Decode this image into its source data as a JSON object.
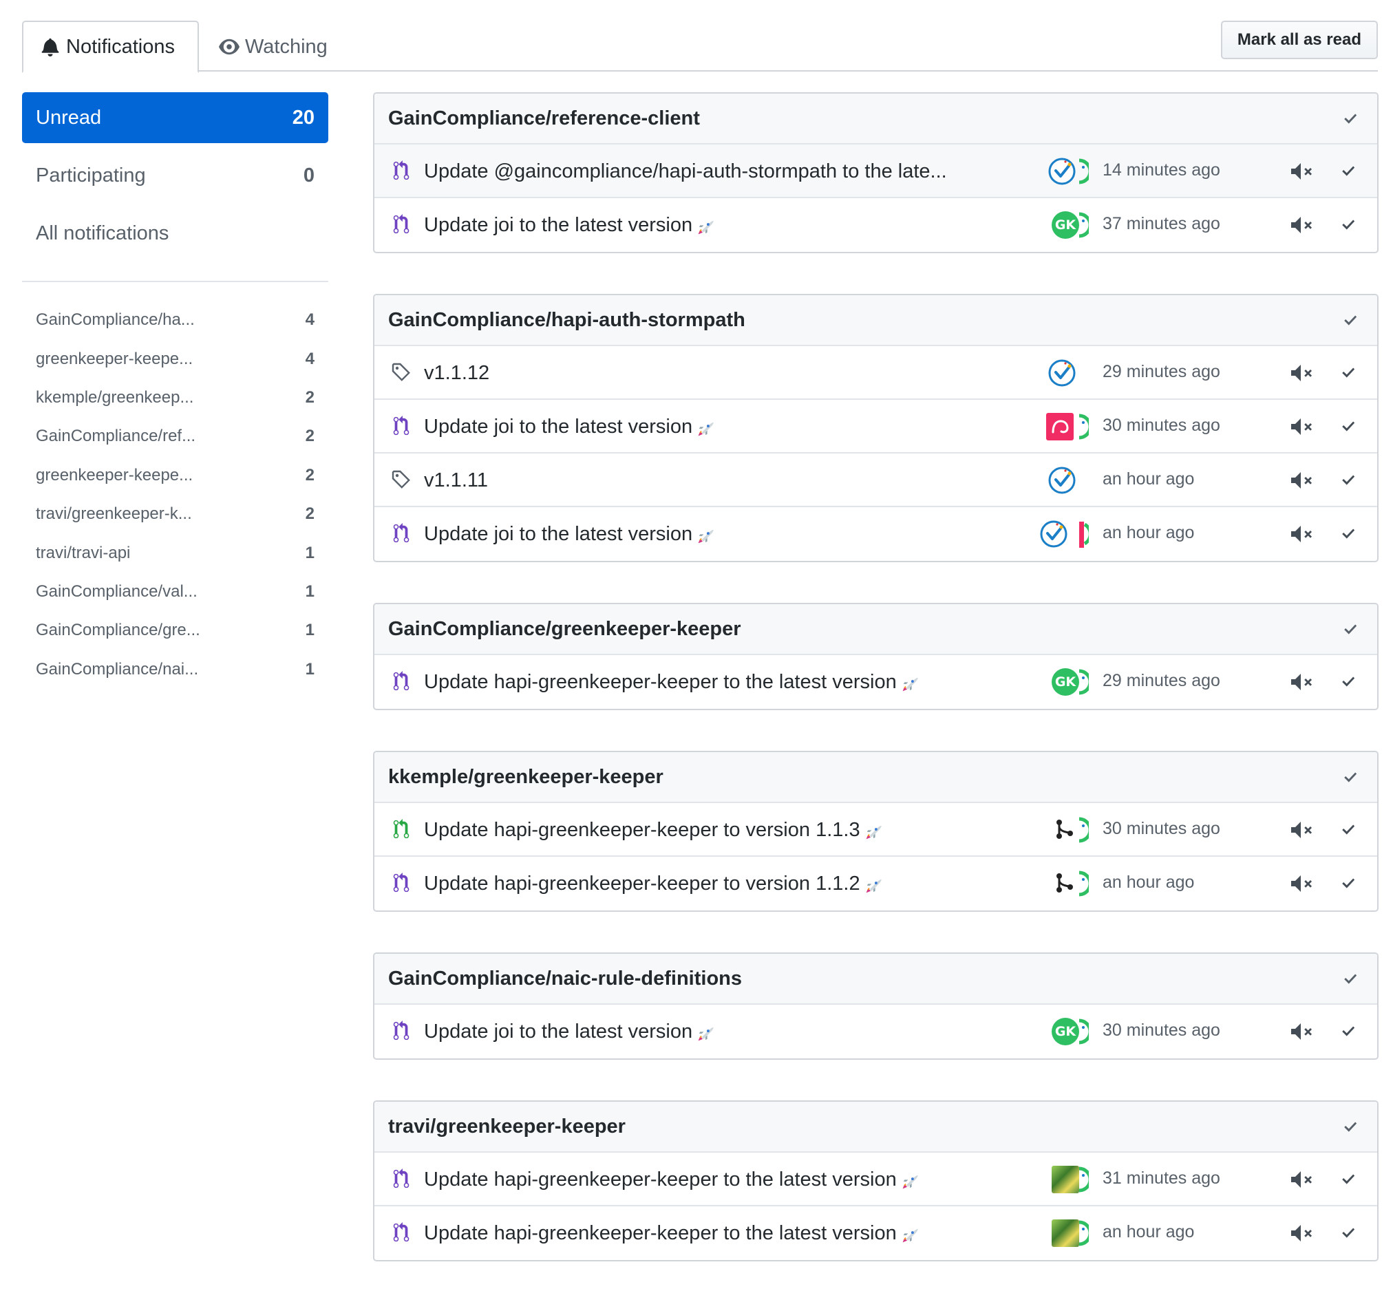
{
  "tabs": {
    "notifications": "Notifications",
    "watching": "Watching"
  },
  "mark_all_read": "Mark all as read",
  "filters": [
    {
      "label": "Unread",
      "count": "20",
      "active": true
    },
    {
      "label": "Participating",
      "count": "0",
      "active": false
    },
    {
      "label": "All notifications",
      "count": "",
      "active": false
    }
  ],
  "repos": [
    {
      "label": "GainCompliance/ha...",
      "count": "4"
    },
    {
      "label": "greenkeeper-keepe...",
      "count": "4"
    },
    {
      "label": "kkemple/greenkeep...",
      "count": "2"
    },
    {
      "label": "GainCompliance/ref...",
      "count": "2"
    },
    {
      "label": "greenkeeper-keepe...",
      "count": "2"
    },
    {
      "label": "travi/greenkeeper-k...",
      "count": "2"
    },
    {
      "label": "travi/travi-api",
      "count": "1"
    },
    {
      "label": "GainCompliance/val...",
      "count": "1"
    },
    {
      "label": "GainCompliance/gre...",
      "count": "1"
    },
    {
      "label": "GainCompliance/nai...",
      "count": "1"
    }
  ],
  "groups": [
    {
      "title": "GainCompliance/reference-client",
      "items": [
        {
          "type": "pr-open",
          "title": "Update @gaincompliance/hapi-auth-stormpath to the late...",
          "rocket": false,
          "avatar": "check-badge",
          "partial": "green",
          "time": "14 minutes ago",
          "hover": true
        },
        {
          "type": "pr-open",
          "title": "Update joi to the latest version",
          "rocket": true,
          "avatar": "gk",
          "partial": "green",
          "time": "37 minutes ago"
        }
      ]
    },
    {
      "title": "GainCompliance/hapi-auth-stormpath",
      "items": [
        {
          "type": "tag",
          "title": "v1.1.12",
          "rocket": false,
          "avatar": "check-badge",
          "partial": "",
          "time": "29 minutes ago"
        },
        {
          "type": "pr-open",
          "title": "Update joi to the latest version",
          "rocket": true,
          "avatar": "pink",
          "partial": "green",
          "time": "30 minutes ago"
        },
        {
          "type": "tag",
          "title": "v1.1.11",
          "rocket": false,
          "avatar": "check-badge",
          "partial": "",
          "time": "an hour ago"
        },
        {
          "type": "pr-open",
          "title": "Update joi to the latest version",
          "rocket": true,
          "avatar": "check-badge",
          "partial": "pink",
          "time": "an hour ago"
        }
      ]
    },
    {
      "title": "GainCompliance/greenkeeper-keeper",
      "items": [
        {
          "type": "pr-open",
          "title": "Update hapi-greenkeeper-keeper to the latest version",
          "rocket": true,
          "avatar": "gk",
          "partial": "green",
          "time": "29 minutes ago"
        }
      ]
    },
    {
      "title": "kkemple/greenkeeper-keeper",
      "items": [
        {
          "type": "pr-merged",
          "title": "Update hapi-greenkeeper-keeper to version 1.1.3",
          "rocket": true,
          "avatar": "merge-logo",
          "partial": "green",
          "time": "30 minutes ago"
        },
        {
          "type": "pr-open",
          "title": "Update hapi-greenkeeper-keeper to version 1.1.2",
          "rocket": true,
          "avatar": "merge-logo",
          "partial": "green",
          "time": "an hour ago"
        }
      ]
    },
    {
      "title": "GainCompliance/naic-rule-definitions",
      "items": [
        {
          "type": "pr-open",
          "title": "Update joi to the latest version",
          "rocket": true,
          "avatar": "gk",
          "partial": "green",
          "time": "30 minutes ago"
        }
      ]
    },
    {
      "title": "travi/greenkeeper-keeper",
      "items": [
        {
          "type": "pr-open",
          "title": "Update hapi-greenkeeper-keeper to the latest version",
          "rocket": true,
          "avatar": "photo",
          "partial": "green",
          "time": "31 minutes ago"
        },
        {
          "type": "pr-open",
          "title": "Update hapi-greenkeeper-keeper to the latest version",
          "rocket": true,
          "avatar": "photo",
          "partial": "green",
          "time": "an hour ago"
        }
      ]
    }
  ],
  "gk_avatar_text": "GK",
  "colors": {
    "accent": "#0366d6",
    "pr_open": "#6f42c1",
    "pr_merged": "#28a745",
    "muted": "#586069"
  }
}
